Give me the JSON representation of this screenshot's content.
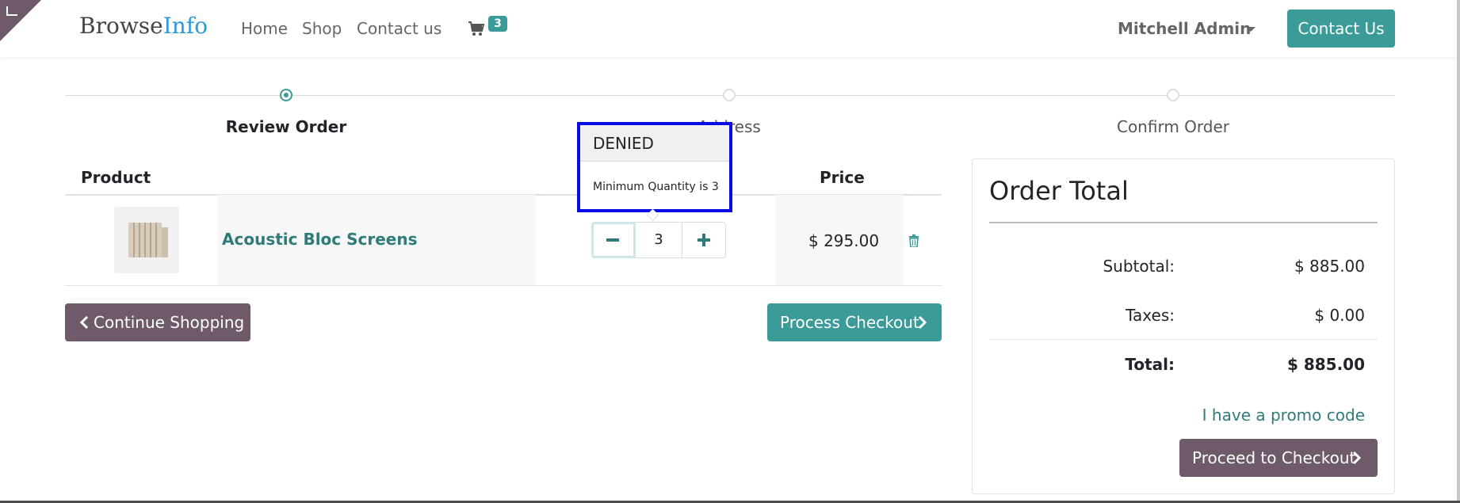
{
  "header": {
    "brand_part1": "Browse",
    "brand_part2": "Info",
    "nav": [
      "Home",
      "Shop",
      "Contact us"
    ],
    "cart_count": "3",
    "user": "Mitchell Admin",
    "contact_button": "Contact Us"
  },
  "steps": [
    {
      "label": "Review Order",
      "active": true
    },
    {
      "label": "Address",
      "active": false
    },
    {
      "label": "Confirm Order",
      "active": false
    }
  ],
  "table": {
    "headers": {
      "product": "Product",
      "price": "Price"
    },
    "row": {
      "name": "Acoustic Bloc Screens",
      "quantity": "3",
      "price": "$ 295.00"
    }
  },
  "buttons": {
    "continue": "Continue Shopping",
    "process": "Process Checkout",
    "proceed": "Proceed to Checkout"
  },
  "popover": {
    "title": "DENIED",
    "message": "Minimum Quantity is 3"
  },
  "order_total": {
    "title": "Order Total",
    "subtotal_label": "Subtotal:",
    "subtotal": "$ 885.00",
    "taxes_label": "Taxes:",
    "taxes": "$ 0.00",
    "total_label": "Total:",
    "total": "$ 885.00",
    "promo": "I have a promo code"
  },
  "colors": {
    "accent": "#3a9b99",
    "secondary": "#6e5a69",
    "popover_border": "#0a0ae6"
  }
}
